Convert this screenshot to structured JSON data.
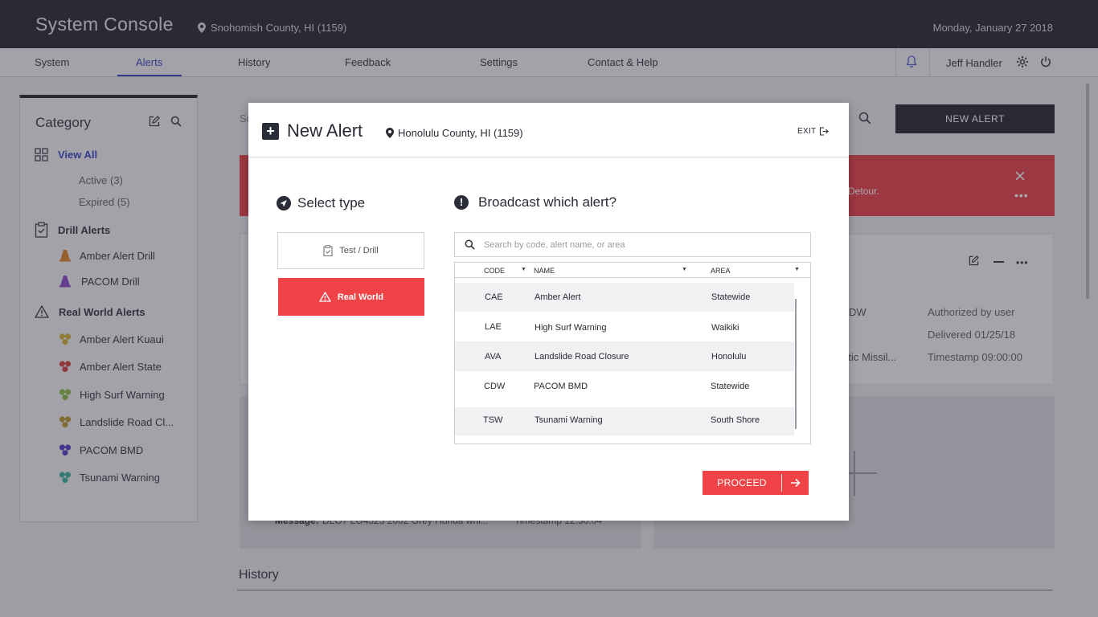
{
  "header": {
    "app_title": "System Console",
    "location": "Snohomish County, HI (1159)",
    "date": "Monday, January 27 2018"
  },
  "nav": {
    "items": [
      {
        "label": "System"
      },
      {
        "label": "Alerts",
        "active": true
      },
      {
        "label": "History"
      },
      {
        "label": "Feedback"
      },
      {
        "label": "Settings"
      },
      {
        "label": "Contact & Help"
      }
    ],
    "user": "Jeff Handler"
  },
  "sidebar": {
    "title": "Category",
    "view_all": "View All",
    "active": "Active (3)",
    "expired": "Expired (5)",
    "drill_section": "Drill Alerts",
    "drill_items": [
      {
        "label": "Amber Alert Drill",
        "color": "#e0852a"
      },
      {
        "label": "PACOM Drill",
        "color": "#8a4fc8"
      }
    ],
    "real_section": "Real World Alerts",
    "real_items": [
      {
        "label": "Amber Alert Kuaui",
        "color": "#d4b33a"
      },
      {
        "label": "Amber Alert State",
        "color": "#d94545"
      },
      {
        "label": "High Surf Warning",
        "color": "#8dbf4a"
      },
      {
        "label": "Landslide Road Cl...",
        "color": "#b89a2e"
      },
      {
        "label": "PACOM BMD",
        "color": "#5a3fc8"
      },
      {
        "label": "Tsunami Warning",
        "color": "#3fb3a0"
      }
    ]
  },
  "background": {
    "search_prefix": "Sc",
    "new_alert_button": "NEW ALERT",
    "banner_text": "Detour.",
    "card_col1": [
      "DW",
      "",
      "istic Missil..."
    ],
    "card_col2": [
      "Authorized by user",
      "Delivered 01/25/18",
      "Timestamp 09:00:00"
    ],
    "tile_message_label": "Message:",
    "tile_message_text": "DLO7 LG4523 2002 Grey Honda whi...",
    "tile_timestamp": "Timestamp 12:30:04",
    "history_title": "History"
  },
  "modal": {
    "title": "New Alert",
    "location": "Honolulu County, HI (1159)",
    "exit_label": "EXIT",
    "select_type_title": "Select type",
    "type_drill": "Test / Drill",
    "type_real": "Real World",
    "broadcast_title": "Broadcast which alert?",
    "search_placeholder": "Search by code, alert name, or area",
    "columns": {
      "code": "CODE",
      "name": "NAME",
      "area": "AREA"
    },
    "rows": [
      {
        "code": "CAE",
        "name": "Amber Alert",
        "area": "Statewide"
      },
      {
        "code": "LAE",
        "name": "High Surf Warning",
        "area": "Waikiki"
      },
      {
        "code": "AVA",
        "name": "Landslide Road Closure",
        "area": "Honolulu"
      },
      {
        "code": "CDW",
        "name": "PACOM BMD",
        "area": "Statewide"
      },
      {
        "code": "TSW",
        "name": "Tsunami Warning",
        "area": "South Shore"
      }
    ],
    "proceed_label": "PROCEED"
  },
  "colors": {
    "accent": "#3d48c4",
    "alert_red": "#f04347",
    "dark": "#2a2c37"
  }
}
